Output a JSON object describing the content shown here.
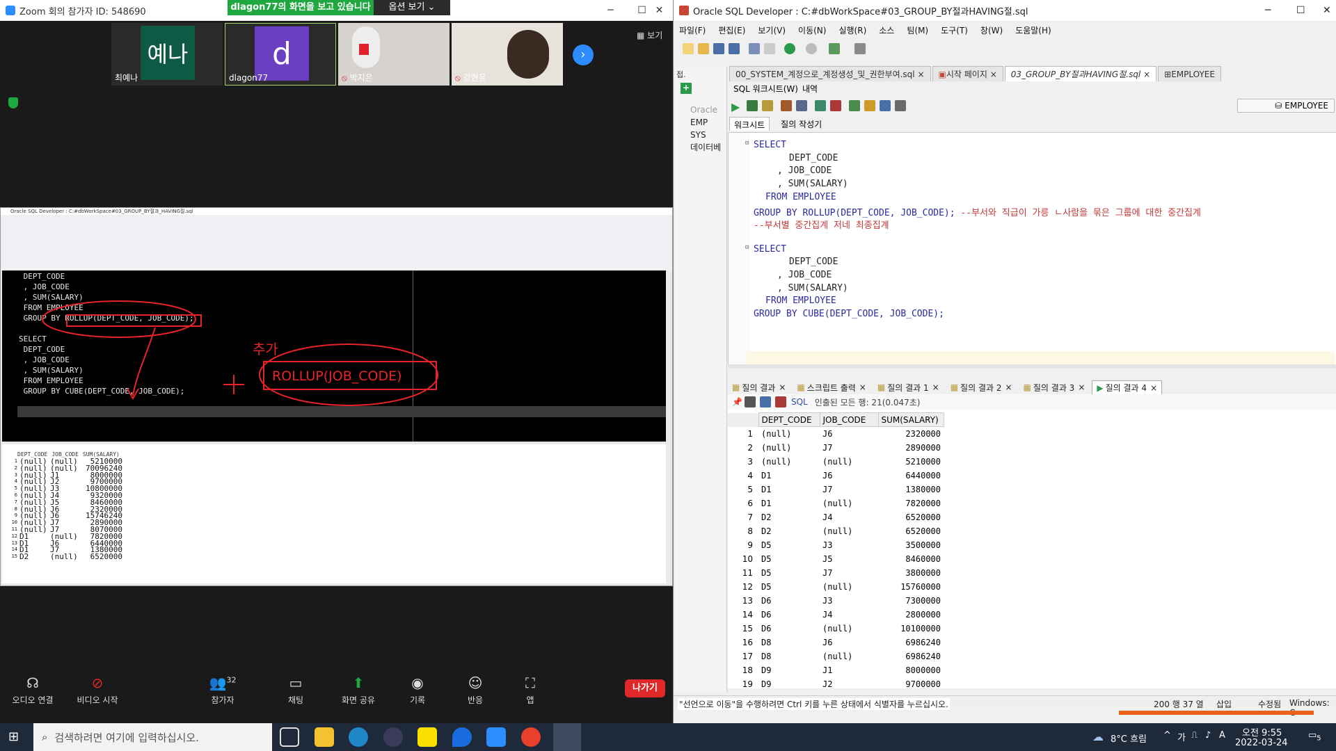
{
  "zoom": {
    "title": "Zoom 회의 참가자 ID: 548690",
    "viewing_banner": "dlagon77의 화면을 보고 있습니다",
    "view_options": "옵션 보기 ⌄",
    "gallery_label": "보기",
    "participants": [
      {
        "name": "최예나",
        "initials": "예나",
        "color": "#0f5a44"
      },
      {
        "name": "dlagon77",
        "initials": "d",
        "color": "#6a3fc2"
      },
      {
        "name": "박지은",
        "initials": "",
        "color": "#c8c4c0"
      },
      {
        "name": "강현윤",
        "initials": "",
        "color": "#d9d3cb"
      }
    ],
    "bottom": {
      "audio": "오디오 연결",
      "video": "비디오 시작",
      "participants": "참가자",
      "participant_count": "32",
      "chat": "채팅",
      "share": "화면 공유",
      "record": "기록",
      "reactions": "반응",
      "apps": "앱",
      "leave": "나가기"
    },
    "shared": {
      "title": "Oracle SQL Developer : C:#dbWorkSpace#03_GROUP_BY절과_HAVING절.sql",
      "annotation_add": "추가",
      "annotation_box": "ROLLUP(JOB_CODE)",
      "lines": [
        " DEPT_CODE",
        " , JOB_CODE",
        " , SUM(SALARY)",
        " FROM EMPLOYEE",
        " GROUP BY ROLLUP(DEPT_CODE, JOB_CODE);",
        "",
        "SELECT",
        " DEPT_CODE",
        " , JOB_CODE",
        " , SUM(SALARY)",
        " FROM EMPLOYEE",
        " GROUP BY CUBE(DEPT_CODE, JOB_CODE);"
      ],
      "result_headers": [
        "DEPT_CODE",
        "JOB_CODE",
        "SUM(SALARY)"
      ],
      "result_rows": [
        [
          "(null)",
          "(null)",
          "5210000"
        ],
        [
          "(null)",
          "(null)",
          "70096240"
        ],
        [
          "(null)",
          "J1",
          "8000000"
        ],
        [
          "(null)",
          "J2",
          "9700000"
        ],
        [
          "(null)",
          "J3",
          "10800000"
        ],
        [
          "(null)",
          "J4",
          "9320000"
        ],
        [
          "(null)",
          "J5",
          "8460000"
        ],
        [
          "(null)",
          "J6",
          "2320000"
        ],
        [
          "(null)",
          "J6",
          "15746240"
        ],
        [
          "(null)",
          "J7",
          "2890000"
        ],
        [
          "(null)",
          "J7",
          "8070000"
        ],
        [
          "D1",
          "(null)",
          "7820000"
        ],
        [
          "D1",
          "J6",
          "6440000"
        ],
        [
          "D1",
          "J7",
          "1380000"
        ],
        [
          "D2",
          "(null)",
          "6520000"
        ]
      ]
    }
  },
  "sqldev": {
    "title": "Oracle SQL Developer : C:#dbWorkSpace#03_GROUP_BY절과HAVING절.sql",
    "menu": [
      "파일(F)",
      "편집(E)",
      "보기(V)",
      "이동(N)",
      "실행(R)",
      "소스",
      "팀(M)",
      "도구(T)",
      "창(W)",
      "도움말(H)"
    ],
    "file_tabs": [
      "00_SYSTEM_계정으로_계정생성_및_권한부여.sql",
      "시작 페이지",
      "03_GROUP_BY절과HAVING절.sql",
      "EMPLOYEE"
    ],
    "worksheet_label": "SQL 워크시트(W)",
    "history_label": "내역",
    "connection": "EMPLOYEE",
    "sub_tabs": [
      "워크시트",
      "질의 작성기"
    ],
    "tree": [
      "Oracle",
      "EMP",
      "SYS",
      "데이터베"
    ],
    "code": [
      {
        "t": "SELECT",
        "indent": 0
      },
      {
        "t": "DEPT_CODE",
        "indent": 3
      },
      {
        "t": ", JOB_CODE",
        "indent": 2
      },
      {
        "t": ", SUM(SALARY)",
        "indent": 2
      },
      {
        "t": "FROM EMPLOYEE",
        "indent": 1
      },
      {
        "t": "GROUP BY ROLLUP(DEPT_CODE, JOB_CODE);",
        "indent": 0,
        "comment": " --부서와 직급이 가릉 ㄴ사람을 묶은 그룹에 대한 중간집계"
      },
      {
        "t": "",
        "indent": 0,
        "comment": "--부서별 중간집계 저네 최종집계"
      },
      {
        "t": "",
        "indent": 0
      },
      {
        "t": "SELECT",
        "indent": 0
      },
      {
        "t": "DEPT_CODE",
        "indent": 3
      },
      {
        "t": ", JOB_CODE",
        "indent": 2
      },
      {
        "t": ", SUM(SALARY)",
        "indent": 2
      },
      {
        "t": "FROM EMPLOYEE",
        "indent": 1
      },
      {
        "t": "GROUP BY CUBE(DEPT_CODE, JOB_CODE);",
        "indent": 0
      }
    ],
    "result_tabs": [
      "질의 결과",
      "스크립트 출력",
      "질의 결과 1",
      "질의 결과 2",
      "질의 결과 3",
      "질의 결과 4"
    ],
    "fetch_info": "인출된 모든 행: 21(0.047초)",
    "sql_label": "SQL",
    "headers": [
      "DEPT_CODE",
      "JOB_CODE",
      "SUM(SALARY)"
    ],
    "rows": [
      [
        "1",
        "(null)",
        "J6",
        "2320000"
      ],
      [
        "2",
        "(null)",
        "J7",
        "2890000"
      ],
      [
        "3",
        "(null)",
        "(null)",
        "5210000"
      ],
      [
        "4",
        "D1",
        "J6",
        "6440000"
      ],
      [
        "5",
        "D1",
        "J7",
        "1380000"
      ],
      [
        "6",
        "D1",
        "(null)",
        "7820000"
      ],
      [
        "7",
        "D2",
        "J4",
        "6520000"
      ],
      [
        "8",
        "D2",
        "(null)",
        "6520000"
      ],
      [
        "9",
        "D5",
        "J3",
        "3500000"
      ],
      [
        "10",
        "D5",
        "J5",
        "8460000"
      ],
      [
        "11",
        "D5",
        "J7",
        "3800000"
      ],
      [
        "12",
        "D5",
        "(null)",
        "15760000"
      ],
      [
        "13",
        "D6",
        "J3",
        "7300000"
      ],
      [
        "14",
        "D6",
        "J4",
        "2800000"
      ],
      [
        "15",
        "D6",
        "(null)",
        "10100000"
      ],
      [
        "16",
        "D8",
        "J6",
        "6986240"
      ],
      [
        "17",
        "D8",
        "(null)",
        "6986240"
      ],
      [
        "18",
        "D9",
        "J1",
        "8000000"
      ],
      [
        "19",
        "D9",
        "J2",
        "9700000"
      ]
    ],
    "status_left": "\"선언으로 이동\"을 수행하려면 Ctrl 키를 누른 상태에서 식별자를 누르십시오.",
    "status_pos": "200 행 37 열",
    "status_mode": "삽입",
    "status_edit": "수정됨",
    "status_os": "Windows: C"
  },
  "taskbar": {
    "search_placeholder": "검색하려면 여기에 입력하십시오.",
    "weather": "8°C 흐림",
    "ime": "A",
    "time": "오전 9:55",
    "date": "2022-03-24",
    "notif": "5"
  }
}
